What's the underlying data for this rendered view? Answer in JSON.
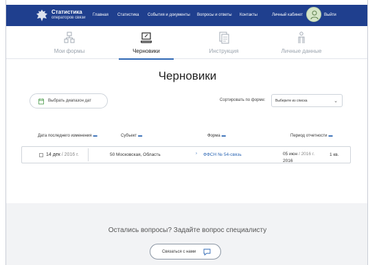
{
  "header": {
    "brand_line1": "Статистика",
    "brand_line2": "операторов связи",
    "nav": [
      "Главная",
      "Статистика",
      "События и документы",
      "Вопросы и ответы",
      "Контакты"
    ],
    "cabinet": "Личный кабинет",
    "logout": "Выйти",
    "bar_color": "#1f3f8e"
  },
  "tabs": [
    {
      "label": "Мои формы",
      "icon": "forms-icon",
      "active": false
    },
    {
      "label": "Черновики",
      "icon": "drafts-laptop-icon",
      "active": true
    },
    {
      "label": "Инструкция",
      "icon": "instruction-icon",
      "active": false
    },
    {
      "label": "Личные данные",
      "icon": "person-icon",
      "active": false
    }
  ],
  "page": {
    "title": "Черновики",
    "range_button": "Выбрать диапазон дат",
    "sort_label": "Сортировать по форме:",
    "sort_value": "Выберите из списка"
  },
  "table": {
    "headers": [
      "Дата последнего изменения",
      "Субъект",
      "Форма",
      "Период отчетности"
    ],
    "rows": [
      {
        "date_day": "14 дек",
        "date_year": "/ 2016 г.",
        "subject": "50 Московская, Область",
        "form": "ФФСН № 54-связь",
        "period_day": "05 июн",
        "period_year": "/ 2016 г.",
        "period_year2": "2016",
        "quarter": "1 кв."
      }
    ]
  },
  "footer": {
    "question": "Остались вопросы? Задайте вопрос специалисту",
    "contact_button": "Связаться с нами"
  },
  "accent": "#2d67b4"
}
